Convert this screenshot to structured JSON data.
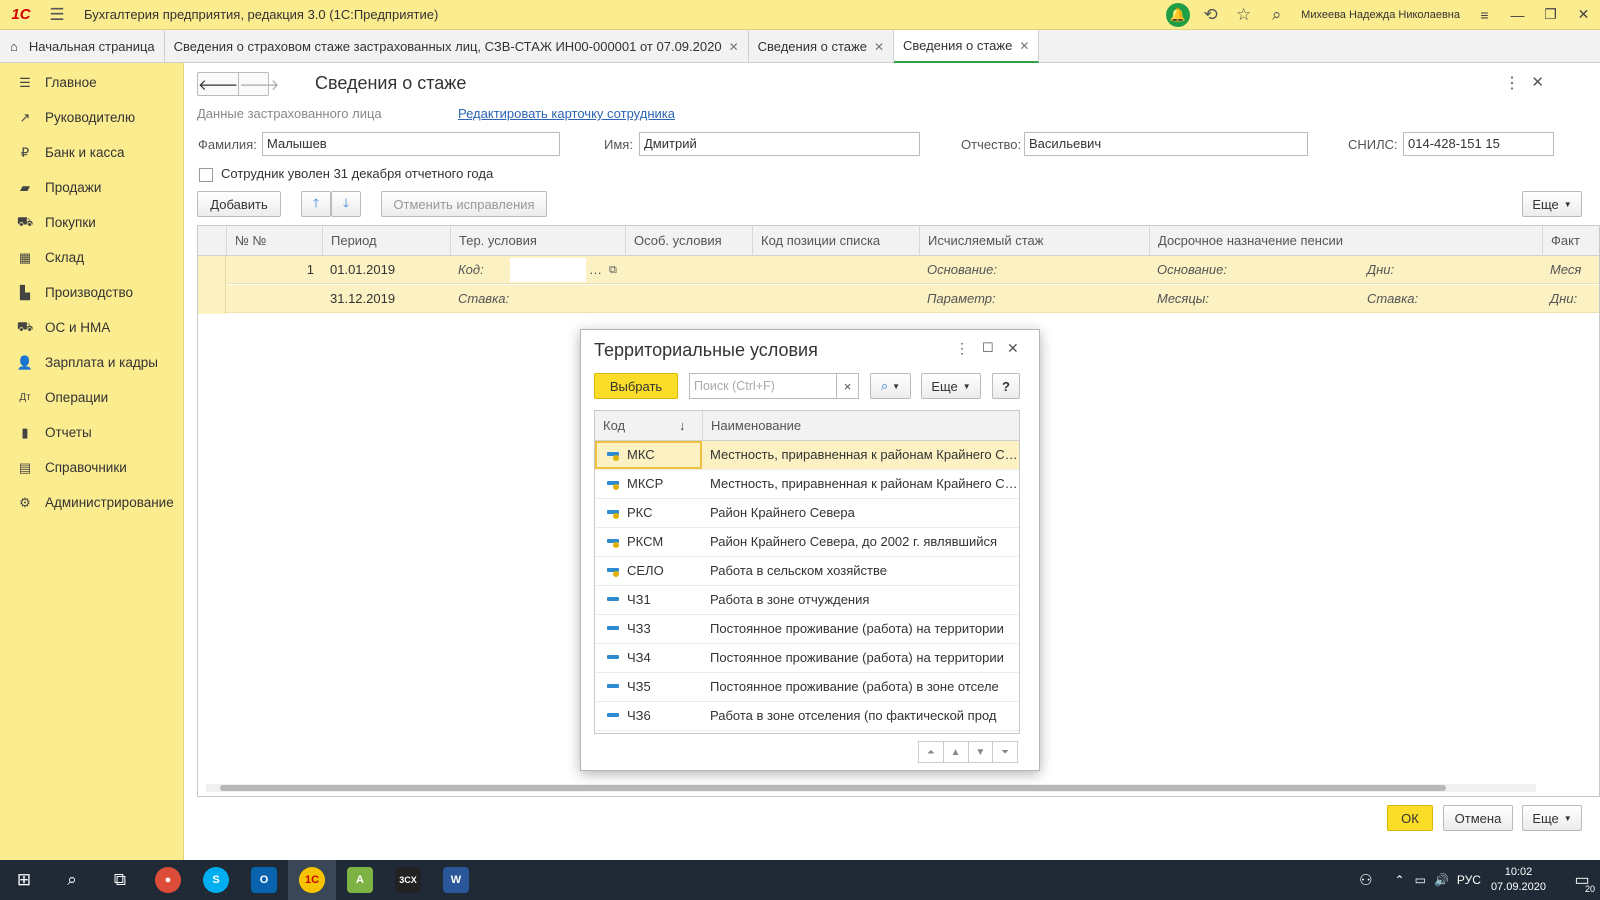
{
  "titlebar": {
    "logo": "1С",
    "app_title": "Бухгалтерия предприятия, редакция 3.0  (1С:Предприятие)",
    "user": "Михеева Надежда Николаевна"
  },
  "tabs": [
    {
      "label": "Начальная страница"
    },
    {
      "label": "Сведения о страховом стаже застрахованных лиц, СЗВ-СТАЖ ИН00-000001 от 07.09.2020"
    },
    {
      "label": "Сведения о стаже"
    },
    {
      "label": "Сведения о стаже"
    }
  ],
  "sidebar": {
    "items": [
      {
        "label": "Главное",
        "icon": "menu-icon"
      },
      {
        "label": "Руководителю",
        "icon": "chart-line-icon"
      },
      {
        "label": "Банк и касса",
        "icon": "ruble-icon"
      },
      {
        "label": "Продажи",
        "icon": "bag-icon"
      },
      {
        "label": "Покупки",
        "icon": "cart-icon"
      },
      {
        "label": "Склад",
        "icon": "warehouse-icon"
      },
      {
        "label": "Производство",
        "icon": "factory-icon"
      },
      {
        "label": "ОС и НМА",
        "icon": "truck-icon"
      },
      {
        "label": "Зарплата и кадры",
        "icon": "person-icon"
      },
      {
        "label": "Операции",
        "icon": "operations-icon"
      },
      {
        "label": "Отчеты",
        "icon": "bar-chart-icon"
      },
      {
        "label": "Справочники",
        "icon": "book-icon"
      },
      {
        "label": "Администрирование",
        "icon": "gear-icon"
      }
    ]
  },
  "form": {
    "title": "Сведения о стаже",
    "insured_label": "Данные застрахованного лица",
    "edit_link": "Редактировать карточку сотрудника",
    "surname_label": "Фамилия:",
    "surname": "Малышев",
    "name_label": "Имя:",
    "name": "Дмитрий",
    "patronymic_label": "Отчество:",
    "patronymic": "Васильевич",
    "snils_label": "СНИЛС:",
    "snils": "014-428-151 15",
    "dismissed_label": "Сотрудник уволен 31 декабря отчетного года",
    "add_button": "Добавить",
    "cancel_fix_button": "Отменить исправления",
    "more_button": "Еще",
    "ok_button": "ОК",
    "cancel_button": "Отмена"
  },
  "grid": {
    "headers": [
      "№ №",
      "Период",
      "Тер. условия",
      "Особ. условия",
      "Код позиции списка",
      "Исчисляемый стаж",
      "Досрочное назначение пенсии",
      "Факт"
    ],
    "row": {
      "num": "1",
      "period_start": "01.01.2019",
      "period_end": "31.12.2019",
      "code_label": "Код:",
      "rate_label": "Ставка:",
      "base_label": "Основание:",
      "param_label": "Параметр:",
      "base2_label": "Основание:",
      "days_label": "Дни:",
      "months_label": "Месяцы:",
      "rate2_label": "Ставка:",
      "mes_label": "Меся",
      "days2_label": "Дни:"
    }
  },
  "modal": {
    "title": "Территориальные условия",
    "select_button": "Выбрать",
    "search_placeholder": "Поиск (Ctrl+F)",
    "more_button": "Еще",
    "help_button": "?",
    "col_code": "Код",
    "col_name": "Наименование",
    "rows": [
      {
        "code": "МКС",
        "name": "Местность, приравненная к районам Крайнего Севера",
        "type": "group"
      },
      {
        "code": "МКСР",
        "name": "Местность, приравненная к районам Крайнего Севера",
        "type": "group"
      },
      {
        "code": "РКС",
        "name": "Район Крайнего Севера",
        "type": "group"
      },
      {
        "code": "РКСМ",
        "name": "Район Крайнего Севера, до 2002 г. являвшийся",
        "type": "group"
      },
      {
        "code": "СЕЛО",
        "name": "Работа в сельском хозяйстве",
        "type": "group"
      },
      {
        "code": "ЧЗ1",
        "name": "Работа в зоне отчуждения",
        "type": "item"
      },
      {
        "code": "ЧЗ3",
        "name": "Постоянное проживание (работа) на территории",
        "type": "item"
      },
      {
        "code": "ЧЗ4",
        "name": "Постоянное проживание (работа) на территории",
        "type": "item"
      },
      {
        "code": "ЧЗ5",
        "name": "Постоянное проживание (работа) в зоне отселе",
        "type": "item"
      },
      {
        "code": "ЧЗ6",
        "name": "Работа в зоне отселения (по фактической прод",
        "type": "item"
      }
    ]
  },
  "taskbar": {
    "lang": "РУС",
    "time": "10:02",
    "date": "07.09.2020",
    "notif_count": "20"
  }
}
